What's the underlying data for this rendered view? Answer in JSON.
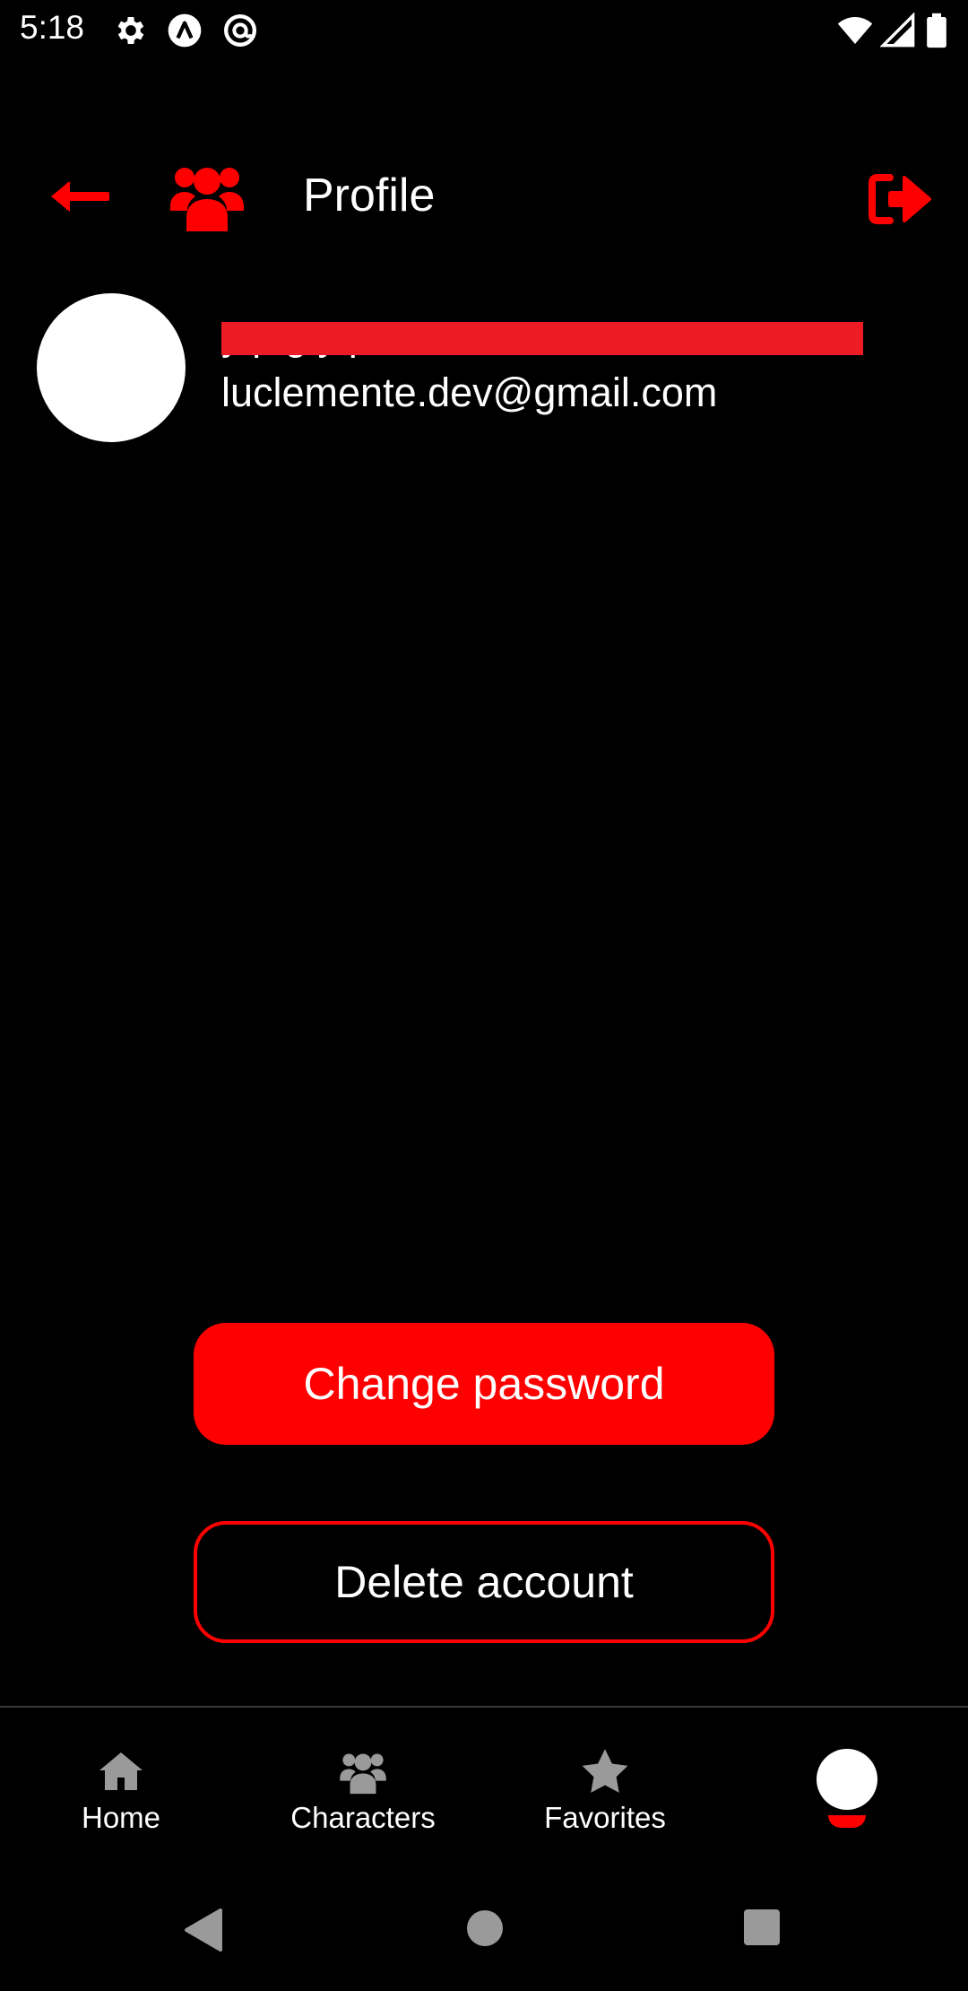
{
  "status_bar": {
    "time": "5:18",
    "icons": [
      "gear-icon",
      "app-a-icon",
      "at-sign-icon",
      "wifi-icon",
      "signal-icon",
      "battery-icon"
    ]
  },
  "app_bar": {
    "title": "Profile",
    "accent_color": "#ff0000"
  },
  "profile": {
    "name": "y p g y p",
    "email": "luclemente.dev@gmail.com",
    "redaction_color": "#ed1c24"
  },
  "actions": {
    "change_password_label": "Change password",
    "delete_account_label": "Delete account"
  },
  "bottom_nav": {
    "items": [
      {
        "label": "Home",
        "icon": "home-icon"
      },
      {
        "label": "Characters",
        "icon": "group-icon"
      },
      {
        "label": "Favorites",
        "icon": "star-icon"
      },
      {
        "label": "",
        "icon": "profile-icon",
        "active": true
      }
    ]
  },
  "system_nav": {
    "buttons": [
      "back-icon",
      "home-circle-icon",
      "recents-icon"
    ]
  }
}
